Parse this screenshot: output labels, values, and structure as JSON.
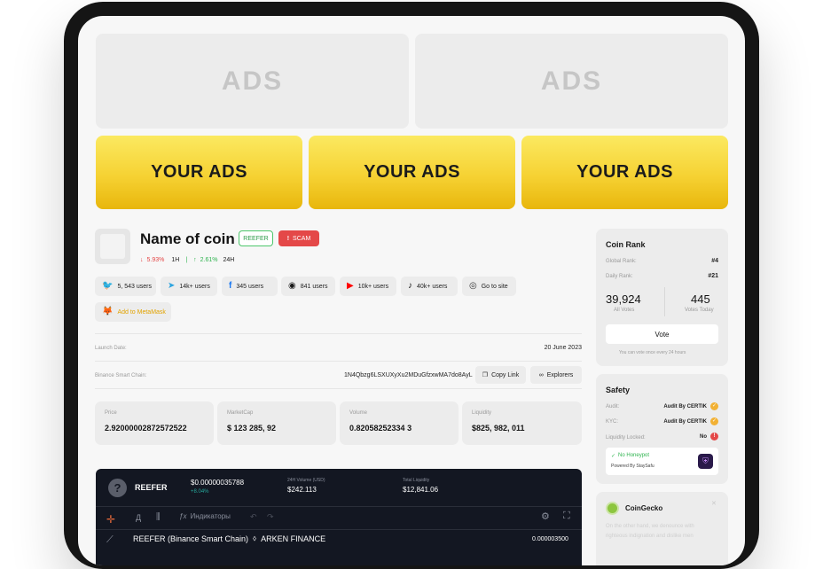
{
  "ads": {
    "top": [
      "ADS",
      "ADS"
    ],
    "yellow": [
      "YOUR ADS",
      "YOUR ADS",
      "YOUR ADS"
    ]
  },
  "coin": {
    "name": "Name of coin",
    "badge_green": "REEFER",
    "badge_red": "SCAM",
    "change_1h": "5.93%",
    "label_1h": "1H",
    "change_24h": "2.61%",
    "label_24h": "24H"
  },
  "socials": [
    {
      "icon": "twitter-icon",
      "label": "5, 543 users"
    },
    {
      "icon": "telegram-icon",
      "label": "14k+ users"
    },
    {
      "icon": "facebook-icon",
      "label": "345 users"
    },
    {
      "icon": "discord-icon",
      "label": "841 users"
    },
    {
      "icon": "youtube-icon",
      "label": "10k+ users"
    },
    {
      "icon": "tiktok-icon",
      "label": "40k+ users"
    },
    {
      "icon": "globe-icon",
      "label": "Go to site"
    }
  ],
  "metamask": {
    "label": "Add to MetaMask"
  },
  "info": {
    "launch_label": "Launch Date:",
    "launch_value": "20 June 2023",
    "chain_label": "Binance Smart Chain:",
    "address": "1N4Qbzg6LSXUXyXu2MDuGfzxwMA7do8AyL",
    "copy_label": "Copy Link",
    "explorers_label": "Explorers"
  },
  "stats": [
    {
      "label": "Price",
      "value": "2.92000002872572522"
    },
    {
      "label": "MarketCap",
      "value": "$ 123 285, 92"
    },
    {
      "label": "Volume",
      "value": "0.82058252334 3"
    },
    {
      "label": "Liquidity",
      "value": "$825, 982, 011"
    }
  ],
  "chart": {
    "token": "REEFER",
    "price": "$0.00000035788",
    "price_change": "+8.04%",
    "vol_label": "24H Volume (USD)",
    "vol_value": "$242.113",
    "liq_label": "Total Liquidity",
    "liq_value": "$12,841.06",
    "tool_a": "Д",
    "indicators": "Индикаторы",
    "pair": "REEFER (Binance Smart Chain)",
    "exchange": "ARKEN FINANCE",
    "price_axis": "0.000003500"
  },
  "rank": {
    "title": "Coin Rank",
    "global_label": "Global Rank:",
    "global_value": "#4",
    "daily_label": "Daily Rank:",
    "daily_value": "#21",
    "all_votes": "39,924",
    "all_votes_label": "All Votes",
    "today_votes": "445",
    "today_votes_label": "Votes Today",
    "vote_button": "Vote",
    "vote_note": "You can vote once every 24 hours"
  },
  "safety": {
    "title": "Safety",
    "audit_label": "Audit:",
    "audit_value": "Audit By CERTIK",
    "kyc_label": "KYC:",
    "kyc_value": "Audit By CERTIK",
    "liq_label": "Liquidity Locked:",
    "liq_value": "No",
    "honeypot": "No Honeypot",
    "powered": "Powered By StaySafu"
  },
  "coingecko": {
    "title": "CoinGecko",
    "text_line1": "On the other hand, we denounce with",
    "text_line2": "righteous indignation and dislike men"
  },
  "colors": {
    "accent_yellow": "#f6d233",
    "down_red": "#e44848",
    "up_green": "#2fb34f",
    "chart_bg": "#131722"
  }
}
